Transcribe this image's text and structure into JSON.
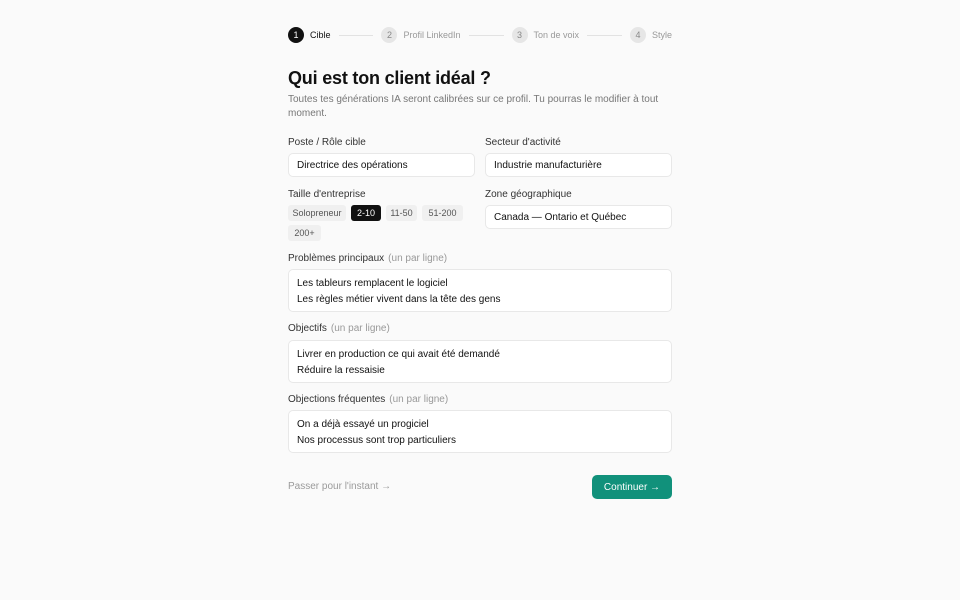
{
  "stepper": {
    "steps": [
      {
        "num": "1",
        "label": "Cible"
      },
      {
        "num": "2",
        "label": "Profil LinkedIn"
      },
      {
        "num": "3",
        "label": "Ton de voix"
      },
      {
        "num": "4",
        "label": "Style"
      }
    ],
    "active_step": 1
  },
  "header": {
    "title": "Qui est ton client idéal ?",
    "subtitle": "Toutes tes générations IA seront calibrées sur ce profil. Tu pourras le modifier à tout moment."
  },
  "form": {
    "role": {
      "label": "Poste / Rôle cible",
      "value": "Directrice des opérations"
    },
    "sector": {
      "label": "Secteur d'activité",
      "value": "Industrie manufacturière"
    },
    "company_size": {
      "label": "Taille d'entreprise",
      "options": [
        "Solopreneur",
        "2-10",
        "11-50",
        "51-200",
        "200+"
      ],
      "selected": "2-10"
    },
    "zone": {
      "label": "Zone géographique",
      "value": "Canada — Ontario et Québec"
    },
    "problems": {
      "label": "Problèmes principaux",
      "hint": "(un par ligne)",
      "lines": [
        "Les tableurs remplacent le logiciel",
        "Les règles métier vivent dans la tête des gens"
      ]
    },
    "goals": {
      "label": "Objectifs",
      "hint": "(un par ligne)",
      "lines": [
        "Livrer en production ce qui avait été demandé",
        "Réduire la ressaisie"
      ]
    },
    "objections": {
      "label": "Objections fréquentes",
      "hint": "(un par ligne)",
      "lines": [
        "On a déjà essayé un progiciel",
        "Nos processus sont trop particuliers"
      ]
    }
  },
  "footer": {
    "skip_label": "Passer pour l'instant →",
    "continue_label": "Continuer →"
  },
  "colors": {
    "accent": "#11917b",
    "active_step": "#111111"
  }
}
